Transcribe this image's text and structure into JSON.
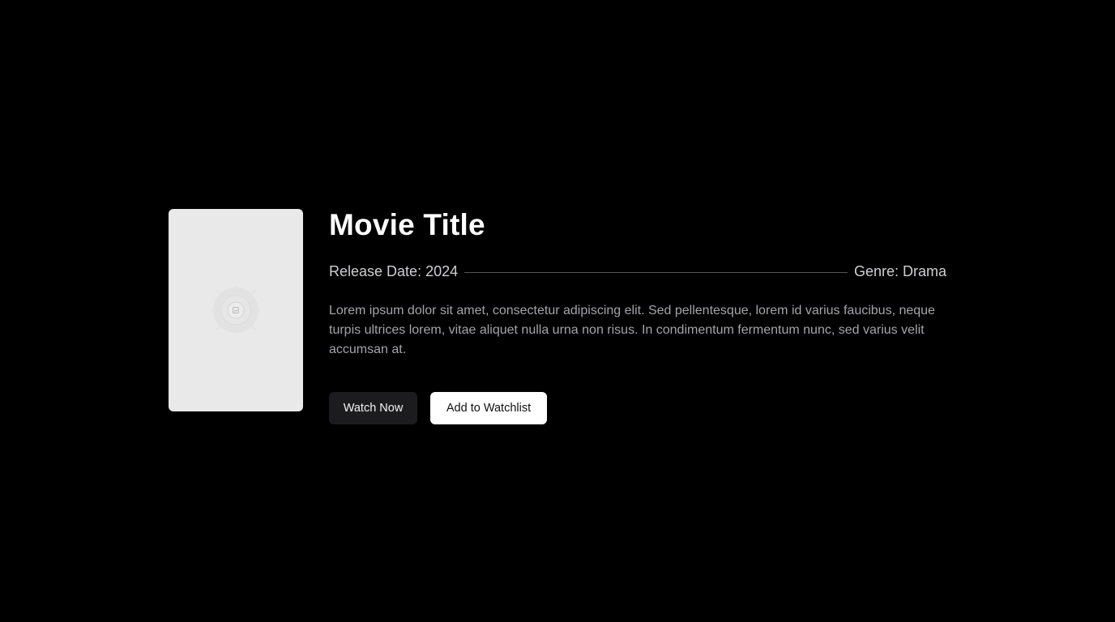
{
  "movie": {
    "title": "Movie Title",
    "release_date": "Release Date: 2024",
    "genre": "Genre: Drama",
    "description": "Lorem ipsum dolor sit amet, consectetur adipiscing elit. Sed pellentesque, lorem id varius faucibus, neque turpis ultrices lorem, vitae aliquet nulla urna non risus. In condimentum fermentum nunc, sed varius velit accumsan at."
  },
  "poster": {
    "icon": "image-placeholder-icon"
  },
  "actions": {
    "watch_label": "Watch Now",
    "watchlist_label": "Add to Watchlist"
  },
  "colors": {
    "background": "#000000",
    "poster_placeholder": "#e9e9e9",
    "primary_button": "#1c1c1f",
    "secondary_button": "#ffffff"
  }
}
